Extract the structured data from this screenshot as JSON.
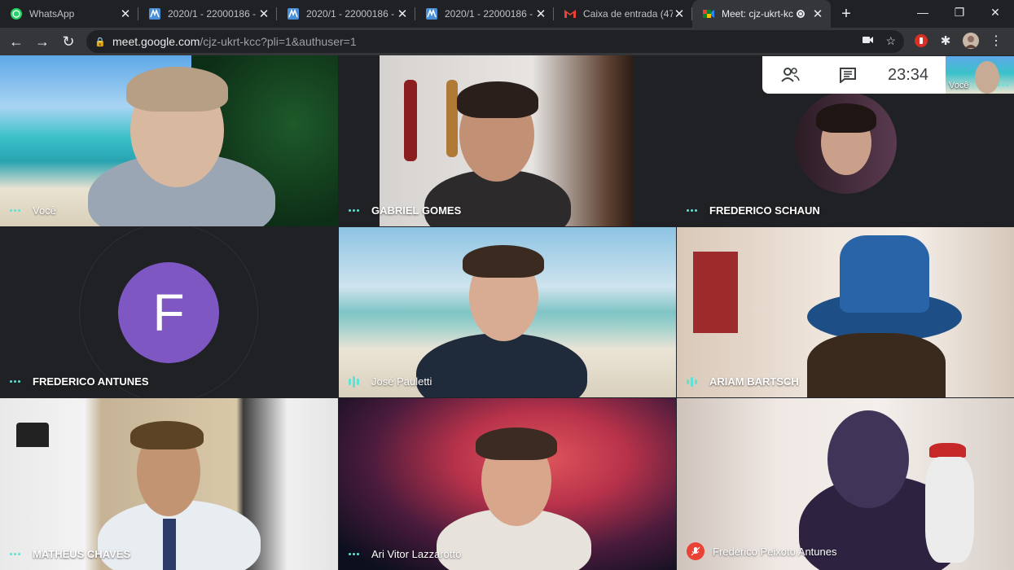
{
  "browser": {
    "tabs": [
      {
        "title": "WhatsApp",
        "icon": "whatsapp-icon"
      },
      {
        "title": "2020/1 - 22000186 -",
        "icon": "moodle-icon"
      },
      {
        "title": "2020/1 - 22000186 -",
        "icon": "moodle-icon"
      },
      {
        "title": "2020/1 - 22000186 -",
        "icon": "moodle-icon"
      },
      {
        "title": "Caixa de entrada (47",
        "icon": "gmail-icon"
      },
      {
        "title": "Meet: cjz-ukrt-kc",
        "icon": "meet-icon",
        "active": true,
        "recording": true
      }
    ],
    "url_host": "meet.google.com",
    "url_path": "/cjz-ukrt-kcc?pli=1&authuser=1"
  },
  "meet": {
    "clock": "23:34",
    "self_label": "Você",
    "participants": [
      {
        "name": "Você",
        "status": "dots"
      },
      {
        "name": "GABRIEL GOMES",
        "status": "dots"
      },
      {
        "name": "FREDERICO SCHAUN",
        "status": "dots"
      },
      {
        "name": "FREDERICO ANTUNES",
        "status": "dots",
        "avatar_letter": "F",
        "avatar_color": "#7e57c2"
      },
      {
        "name": "José Pauletti",
        "status": "speaking"
      },
      {
        "name": "ARIAM BARTSCH",
        "status": "speaking"
      },
      {
        "name": "MATHEUS CHAVES",
        "status": "dots"
      },
      {
        "name": "Ari Vitor Lazzarotto",
        "status": "dots"
      },
      {
        "name": "Frederico Peixoto Antunes",
        "status": "muted"
      }
    ]
  },
  "colors": {
    "accent_teal": "#5ee2d4",
    "muted_red": "#ea4335",
    "avatar_purple": "#7e57c2"
  }
}
